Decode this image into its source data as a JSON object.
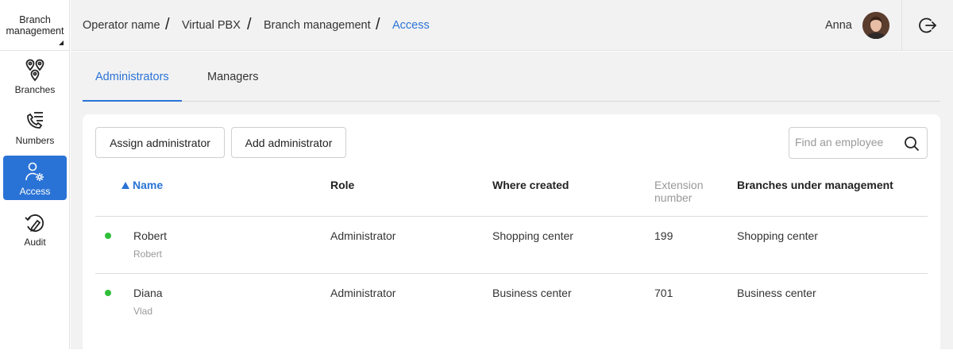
{
  "brand": {
    "line1": "Branch",
    "line2": "management"
  },
  "nav": [
    {
      "label": "Branches",
      "icon": "branches-icon"
    },
    {
      "label": "Numbers",
      "icon": "numbers-icon"
    },
    {
      "label": "Access",
      "icon": "access-icon",
      "active": true
    },
    {
      "label": "Audit",
      "icon": "audit-icon"
    }
  ],
  "breadcrumb": {
    "items": [
      "Operator name",
      "Virtual PBX",
      "Branch management",
      "Access"
    ],
    "separator": "/"
  },
  "user": {
    "name": "Anna"
  },
  "tabs": [
    {
      "label": "Administrators",
      "active": true
    },
    {
      "label": "Managers"
    }
  ],
  "toolbar": {
    "assign_label": "Assign administrator",
    "add_label": "Add administrator",
    "search_placeholder": "Find an employee"
  },
  "table": {
    "columns": {
      "name": "Name",
      "role": "Role",
      "where_created": "Where created",
      "extension_line1": "Extension",
      "extension_line2": "number",
      "branches": "Branches under management"
    },
    "rows": [
      {
        "name": "Robert",
        "sub": "Robert",
        "role": "Administrator",
        "where_created": "Shopping center",
        "extension": "199",
        "branches": "Shopping center",
        "status": "online"
      },
      {
        "name": "Diana",
        "sub": "Vlad",
        "role": "Administrator",
        "where_created": "Business center",
        "extension": "701",
        "branches": "Business center",
        "status": "online"
      }
    ]
  },
  "colors": {
    "accent": "#2a73d6",
    "status_online": "#2fbf3a",
    "background": "#f2f2f2"
  }
}
